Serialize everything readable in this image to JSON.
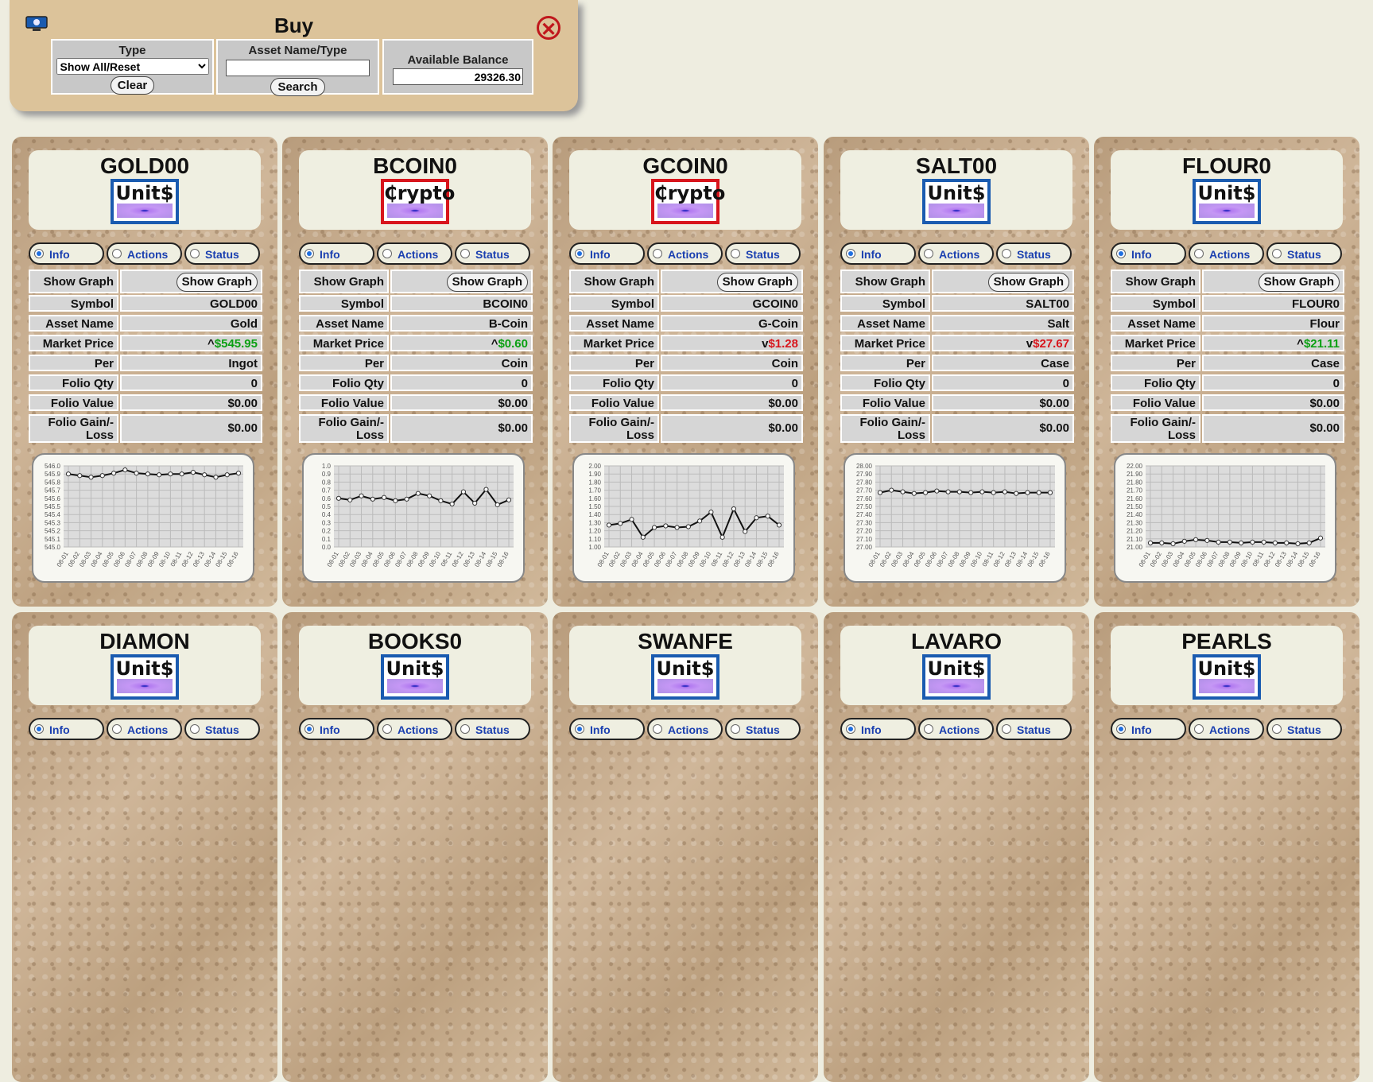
{
  "buy_panel": {
    "title": "Buy",
    "close_icon": "close-x-icon",
    "type_label": "Type",
    "type_selected": "Show All/Reset",
    "clear_label": "Clear",
    "name_label": "Asset Name/Type",
    "name_value": "",
    "search_label": "Search",
    "balance_label": "Available Balance",
    "balance_value": "29326.30"
  },
  "labels": {
    "tab_info": "Info",
    "tab_actions": "Actions",
    "tab_status": "Status",
    "show_graph": "Show Graph",
    "symbol": "Symbol",
    "asset_name": "Asset Name",
    "market_price": "Market Price",
    "per": "Per",
    "folio_qty": "Folio Qty",
    "folio_value": "Folio Value",
    "folio_gain_loss": "Folio Gain/-Loss"
  },
  "cards": [
    {
      "symbol": "GOLD00",
      "badge": "Unit$",
      "badge_type": "unit",
      "asset_name": "Gold",
      "price_dir": "^",
      "price": "$545.95",
      "price_trend": "up",
      "per": "Ingot",
      "folio_qty": "0",
      "folio_value": "$0.00",
      "folio_gain": "$0.00",
      "chart_data": {
        "type": "line",
        "y_ticks": [
          "546.0",
          "545.9",
          "545.8",
          "545.7",
          "545.6",
          "545.5",
          "545.4",
          "545.3",
          "545.2",
          "545.1",
          "545.0"
        ],
        "ylim": [
          545.0,
          546.0
        ],
        "x": [
          "08-01",
          "08-02",
          "08-03",
          "08-04",
          "08-05",
          "08-06",
          "08-07",
          "08-08",
          "08-09",
          "08-10",
          "08-11",
          "08-12",
          "08-13",
          "08-14",
          "08-15",
          "08-16"
        ],
        "values": [
          545.9,
          545.88,
          545.86,
          545.88,
          545.91,
          545.95,
          545.91,
          545.9,
          545.89,
          545.9,
          545.9,
          545.92,
          545.89,
          545.86,
          545.89,
          545.91
        ]
      }
    },
    {
      "symbol": "BCOIN0",
      "badge": "₵rypto",
      "badge_type": "crypto",
      "asset_name": "B-Coin",
      "price_dir": "^",
      "price": "$0.60",
      "price_trend": "up",
      "per": "Coin",
      "folio_qty": "0",
      "folio_value": "$0.00",
      "folio_gain": "$0.00",
      "chart_data": {
        "type": "line",
        "y_ticks": [
          "1.0",
          "0.9",
          "0.8",
          "0.7",
          "0.6",
          "0.5",
          "0.4",
          "0.3",
          "0.2",
          "0.1",
          "0.0"
        ],
        "ylim": [
          0,
          1
        ],
        "x": [
          "08-01",
          "08-02",
          "08-03",
          "08-04",
          "08-05",
          "08-06",
          "08-07",
          "08-08",
          "08-09",
          "08-10",
          "08-11",
          "08-12",
          "08-13",
          "08-14",
          "08-15",
          "08-16"
        ],
        "values": [
          0.6,
          0.58,
          0.63,
          0.59,
          0.61,
          0.57,
          0.59,
          0.66,
          0.63,
          0.57,
          0.53,
          0.68,
          0.54,
          0.71,
          0.52,
          0.58
        ]
      }
    },
    {
      "symbol": "GCOIN0",
      "badge": "₵rypto",
      "badge_type": "crypto",
      "asset_name": "G-Coin",
      "price_dir": "v",
      "price": "$1.28",
      "price_trend": "down",
      "per": "Coin",
      "folio_qty": "0",
      "folio_value": "$0.00",
      "folio_gain": "$0.00",
      "chart_data": {
        "type": "line",
        "y_ticks": [
          "2.00",
          "1.90",
          "1.80",
          "1.70",
          "1.60",
          "1.50",
          "1.40",
          "1.30",
          "1.20",
          "1.10",
          "1.00"
        ],
        "ylim": [
          1.0,
          2.0
        ],
        "x": [
          "08-01",
          "08-02",
          "08-03",
          "08-04",
          "08-05",
          "08-06",
          "08-07",
          "08-08",
          "08-09",
          "08-10",
          "08-11",
          "08-12",
          "08-13",
          "08-14",
          "08-15",
          "08-16"
        ],
        "values": [
          1.27,
          1.29,
          1.34,
          1.12,
          1.24,
          1.26,
          1.24,
          1.25,
          1.32,
          1.43,
          1.12,
          1.47,
          1.19,
          1.36,
          1.38,
          1.27
        ]
      }
    },
    {
      "symbol": "SALT00",
      "badge": "Unit$",
      "badge_type": "unit",
      "asset_name": "Salt",
      "price_dir": "v",
      "price": "$27.67",
      "price_trend": "down",
      "per": "Case",
      "folio_qty": "0",
      "folio_value": "$0.00",
      "folio_gain": "$0.00",
      "chart_data": {
        "type": "line",
        "y_ticks": [
          "28.00",
          "27.90",
          "27.80",
          "27.70",
          "27.60",
          "27.50",
          "27.40",
          "27.30",
          "27.20",
          "27.10",
          "27.00"
        ],
        "ylim": [
          27.0,
          28.0
        ],
        "x": [
          "08-01",
          "08-02",
          "08-03",
          "08-04",
          "08-05",
          "08-06",
          "08-07",
          "08-08",
          "08-09",
          "08-10",
          "08-11",
          "08-12",
          "08-13",
          "08-14",
          "08-15",
          "08-16"
        ],
        "values": [
          27.67,
          27.7,
          27.68,
          27.66,
          27.67,
          27.69,
          27.68,
          27.68,
          27.67,
          27.68,
          27.67,
          27.68,
          27.66,
          27.67,
          27.67,
          27.67
        ]
      }
    },
    {
      "symbol": "FLOUR0",
      "badge": "Unit$",
      "badge_type": "unit",
      "asset_name": "Flour",
      "price_dir": "^",
      "price": "$21.11",
      "price_trend": "up",
      "per": "Case",
      "folio_qty": "0",
      "folio_value": "$0.00",
      "folio_gain": "$0.00",
      "chart_data": {
        "type": "line",
        "y_ticks": [
          "22.00",
          "21.90",
          "21.80",
          "21.70",
          "21.60",
          "21.50",
          "21.40",
          "21.30",
          "21.20",
          "21.10",
          "21.00"
        ],
        "ylim": [
          21.0,
          22.0
        ],
        "x": [
          "08-01",
          "08-02",
          "08-03",
          "08-04",
          "08-05",
          "08-06",
          "08-07",
          "08-08",
          "08-09",
          "08-10",
          "08-11",
          "08-12",
          "08-13",
          "08-14",
          "08-15",
          "08-16"
        ],
        "values": [
          21.05,
          21.05,
          21.04,
          21.07,
          21.09,
          21.08,
          21.06,
          21.06,
          21.05,
          21.06,
          21.06,
          21.05,
          21.05,
          21.04,
          21.05,
          21.11
        ]
      }
    },
    {
      "symbol": "DIAMON",
      "badge": "Unit$",
      "badge_type": "unit"
    },
    {
      "symbol": "BOOKS0",
      "badge": "Unit$",
      "badge_type": "unit"
    },
    {
      "symbol": "SWANFE",
      "badge": "Unit$",
      "badge_type": "unit"
    },
    {
      "symbol": "LAVARO",
      "badge": "Unit$",
      "badge_type": "unit"
    },
    {
      "symbol": "PEARLS",
      "badge": "Unit$",
      "badge_type": "unit"
    }
  ]
}
